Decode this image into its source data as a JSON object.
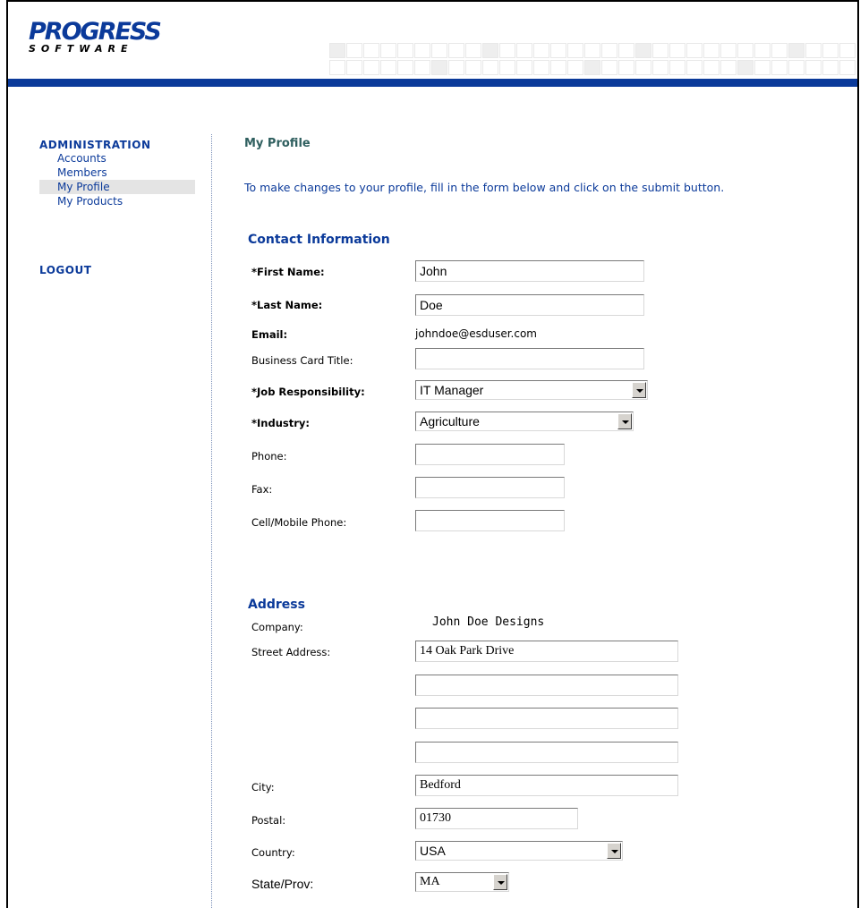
{
  "logo": {
    "main": "PROGRESS",
    "sub": "SOFTWARE"
  },
  "sidebar": {
    "heading": "ADMINISTRATION",
    "items": [
      {
        "label": "Accounts"
      },
      {
        "label": "Members"
      },
      {
        "label": "My Profile"
      },
      {
        "label": "My Products"
      }
    ],
    "logout": "LOGOUT"
  },
  "page": {
    "title": "My Profile",
    "intro": "To make changes to your profile, fill in the form below and click on the submit button."
  },
  "contact": {
    "section_title": "Contact Information",
    "first_name_label": "*First Name:",
    "first_name_value": "John",
    "last_name_label": "*Last Name:",
    "last_name_value": "Doe",
    "email_label": "Email:",
    "email_value": "johndoe@esduser.com",
    "bct_label": "Business Card Title:",
    "bct_value": "",
    "job_label": "*Job Responsibility:",
    "job_value": "IT Manager",
    "industry_label": "*Industry:",
    "industry_value": "Agriculture",
    "phone_label": "Phone:",
    "phone_value": "",
    "fax_label": "Fax:",
    "fax_value": "",
    "cell_label": "Cell/Mobile Phone:",
    "cell_value": ""
  },
  "address": {
    "section_title": "Address",
    "company_label": "Company:",
    "company_value": "John Doe Designs",
    "street_label": "Street Address:",
    "street1_value": "14 Oak Park Drive",
    "street2_value": "",
    "street3_value": "",
    "street4_value": "",
    "city_label": "City:",
    "city_value": "Bedford",
    "postal_label": "Postal:",
    "postal_value": "01730",
    "country_label": "Country:",
    "country_value": "USA",
    "state_label": "State/Prov:",
    "state_value": "MA"
  },
  "colors": {
    "brand_blue": "#0b3a9a",
    "title_teal": "#2f5f5f"
  }
}
